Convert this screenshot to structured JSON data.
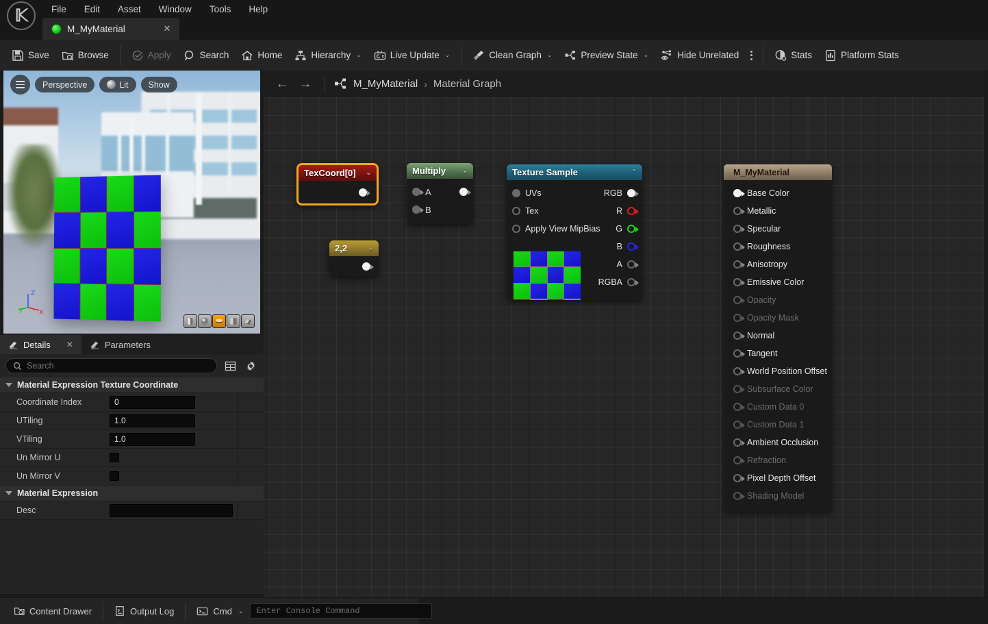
{
  "app": {
    "logo": "unreal-engine-logo",
    "menu": [
      "File",
      "Edit",
      "Asset",
      "Window",
      "Tools",
      "Help"
    ],
    "tab": {
      "label": "M_MyMaterial",
      "close": "✕"
    }
  },
  "toolbar": {
    "items": [
      {
        "label": "Save",
        "icon": "save-icon",
        "caret": false,
        "disabled": false
      },
      {
        "label": "Browse",
        "icon": "browse-icon",
        "caret": false,
        "disabled": false
      },
      {
        "label": "Apply",
        "icon": "apply-icon",
        "caret": false,
        "disabled": true
      },
      {
        "label": "Search",
        "icon": "search-icon",
        "caret": false,
        "disabled": false
      },
      {
        "label": "Home",
        "icon": "home-icon",
        "caret": false,
        "disabled": false
      },
      {
        "label": "Hierarchy",
        "icon": "hierarchy-icon",
        "caret": true,
        "disabled": false
      },
      {
        "label": "Live Update",
        "icon": "live-update-icon",
        "caret": true,
        "disabled": false
      },
      {
        "label": "Clean Graph",
        "icon": "clean-graph-icon",
        "caret": true,
        "disabled": false
      },
      {
        "label": "Preview State",
        "icon": "preview-state-icon",
        "caret": true,
        "disabled": false
      },
      {
        "label": "Hide Unrelated",
        "icon": "hide-unrelated-icon",
        "caret": false,
        "disabled": false
      },
      {
        "label": "Stats",
        "icon": "stats-icon",
        "caret": false,
        "disabled": false
      },
      {
        "label": "Platform Stats",
        "icon": "platform-stats-icon",
        "caret": false,
        "disabled": false
      }
    ],
    "caret": "⌄"
  },
  "viewport": {
    "overlay": {
      "menu_icon": "hamburger-icon",
      "perspective": "Perspective",
      "lit": "Lit",
      "show": "Show"
    },
    "axis": {
      "x": "X",
      "y": "Y",
      "z": "Z"
    },
    "shapes": [
      "cylinder",
      "sphere",
      "plane",
      "cube",
      "custom-mesh"
    ],
    "selected_shape": "plane"
  },
  "details": {
    "tabs": [
      {
        "label": "Details",
        "icon": "details-icon",
        "active": true,
        "closable": true
      },
      {
        "label": "Parameters",
        "icon": "parameters-icon",
        "active": false,
        "closable": false
      }
    ],
    "close_glyph": "✕",
    "search": {
      "placeholder": "Search",
      "value": ""
    },
    "buttons": [
      "column-view-icon",
      "settings-gear-icon"
    ],
    "sections": [
      {
        "title": "Material Expression Texture Coordinate",
        "rows": [
          {
            "name": "Coordinate Index",
            "type": "text",
            "value": "0"
          },
          {
            "name": "UTiling",
            "type": "text",
            "value": "1.0"
          },
          {
            "name": "VTiling",
            "type": "text",
            "value": "1.0"
          },
          {
            "name": "Un Mirror U",
            "type": "checkbox",
            "value": ""
          },
          {
            "name": "Un Mirror V",
            "type": "checkbox",
            "value": ""
          }
        ]
      },
      {
        "title": "Material Expression",
        "rows": [
          {
            "name": "Desc",
            "type": "text-wide",
            "value": ""
          }
        ]
      }
    ]
  },
  "graph": {
    "nav": {
      "back": "←",
      "forward": "→"
    },
    "breadcrumb": {
      "icon": "graph-icon",
      "root": "M_MyMaterial",
      "separator": "›",
      "current": "Material Graph"
    },
    "nodes": [
      {
        "id": "texcoord",
        "title": "TexCoord[0]",
        "caret": "⌄",
        "selected": true,
        "header_color": "#a91b15",
        "outputs": [
          {
            "label": "",
            "pin": "filled"
          }
        ]
      },
      {
        "id": "const",
        "title": "2,2",
        "caret": "⌄",
        "selected": false,
        "header_color": "#b89b32",
        "outputs": [
          {
            "label": "",
            "pin": "filled"
          }
        ]
      },
      {
        "id": "multiply",
        "title": "Multiply",
        "caret": "⌄",
        "selected": false,
        "header_color": "#7aa373",
        "inputs": [
          {
            "label": "A"
          },
          {
            "label": "B"
          }
        ],
        "outputs": [
          {
            "label": "",
            "pin": "filled"
          }
        ]
      },
      {
        "id": "texture-sample",
        "title": "Texture Sample",
        "caret": "⌃",
        "selected": false,
        "header_color": "#2c7f9b",
        "inputs": [
          {
            "label": "UVs",
            "pin": "gray-filled"
          },
          {
            "label": "Tex",
            "pin": "empty"
          },
          {
            "label": "Apply View MipBias",
            "pin": "empty"
          }
        ],
        "outputs": [
          {
            "label": "RGB",
            "pin": "filled",
            "color": "#ffffff"
          },
          {
            "label": "R",
            "pin": "empty",
            "color": "#e01b1b"
          },
          {
            "label": "G",
            "pin": "empty",
            "color": "#13d813"
          },
          {
            "label": "B",
            "pin": "empty",
            "color": "#2525e6"
          },
          {
            "label": "A",
            "pin": "empty",
            "color": "#6b6b6b"
          },
          {
            "label": "RGBA",
            "pin": "empty",
            "color": "#6b6b6b"
          }
        ]
      },
      {
        "id": "material-output",
        "title": "M_MyMaterial",
        "selected": false,
        "header_color": "#b9a58c",
        "inputs": [
          {
            "label": "Base Color",
            "enabled": true,
            "connected": true
          },
          {
            "label": "Metallic",
            "enabled": true,
            "connected": false
          },
          {
            "label": "Specular",
            "enabled": true,
            "connected": false
          },
          {
            "label": "Roughness",
            "enabled": true,
            "connected": false
          },
          {
            "label": "Anisotropy",
            "enabled": true,
            "connected": false
          },
          {
            "label": "Emissive Color",
            "enabled": true,
            "connected": false
          },
          {
            "label": "Opacity",
            "enabled": false,
            "connected": false
          },
          {
            "label": "Opacity Mask",
            "enabled": false,
            "connected": false
          },
          {
            "label": "Normal",
            "enabled": true,
            "connected": false
          },
          {
            "label": "Tangent",
            "enabled": true,
            "connected": false
          },
          {
            "label": "World Position Offset",
            "enabled": true,
            "connected": false
          },
          {
            "label": "Subsurface Color",
            "enabled": false,
            "connected": false
          },
          {
            "label": "Custom Data 0",
            "enabled": false,
            "connected": false
          },
          {
            "label": "Custom Data 1",
            "enabled": false,
            "connected": false
          },
          {
            "label": "Ambient Occlusion",
            "enabled": true,
            "connected": false
          },
          {
            "label": "Refraction",
            "enabled": false,
            "connected": false
          },
          {
            "label": "Pixel Depth Offset",
            "enabled": true,
            "connected": false
          },
          {
            "label": "Shading Model",
            "enabled": false,
            "connected": false
          }
        ]
      }
    ]
  },
  "statusbar": {
    "content_drawer": "Content Drawer",
    "output_log": "Output Log",
    "cmd": "Cmd",
    "cmd_caret": "⌄",
    "console_placeholder": "Enter Console Command"
  },
  "colors": {
    "accent_selection": "#f5a623",
    "panel_bg": "#242424",
    "graph_bg": "#262626",
    "pin_red": "#e01b1b",
    "pin_green": "#13d813",
    "pin_blue": "#2525e6"
  }
}
